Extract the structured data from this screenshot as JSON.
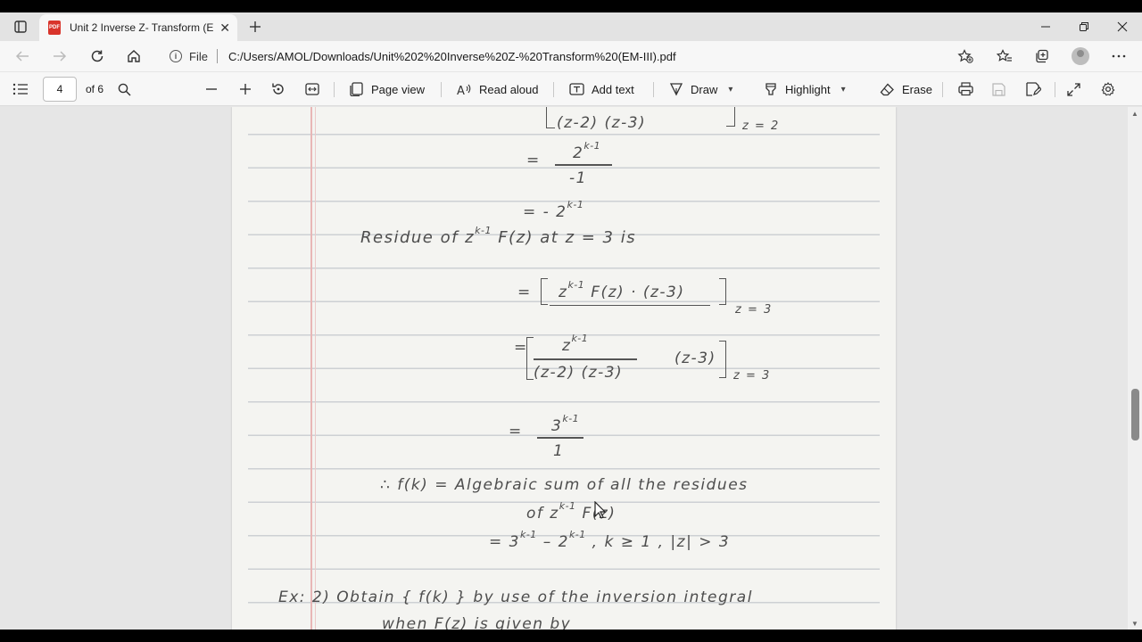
{
  "browser": {
    "tab_title": "Unit 2 Inverse Z- Transform (EM-III).pdf",
    "url_scheme_label": "File",
    "url": "C:/Users/AMOL/Downloads/Unit%202%20Inverse%20Z-%20Transform%20(EM-III).pdf",
    "pdf_badge": "PDF"
  },
  "pdf_toolbar": {
    "current_page": "4",
    "page_count_label": "of 6",
    "page_view_label": "Page view",
    "read_aloud_label": "Read aloud",
    "add_text_label": "Add text",
    "draw_label": "Draw",
    "highlight_label": "Highlight",
    "erase_label": "Erase"
  },
  "document": {
    "line1": "(z-2) (z-3)",
    "line1_sub": "z = 2",
    "line2_num": "2",
    "line2_num_sup": "k-1",
    "line2_den": "-1",
    "line3": "= - 2",
    "line3_sup": "k-1",
    "line4_a": "Residue  of  z",
    "line4_sup": "k-1",
    "line4_b": "F(z)  at  z = 3  is",
    "line5_a": "= ",
    "line5_z": "z",
    "line5_sup": "k-1",
    "line5_b": "F(z) · (z-3)",
    "line5_sub": "z = 3",
    "line6_eq": "=",
    "line6_num": "z",
    "line6_num_sup": "k-1",
    "line6_den": "(z-2) (z-3)",
    "line6_factor": "(z-3)",
    "line6_sub": "z = 3",
    "line7_eq": "=",
    "line7_num": "3",
    "line7_num_sup": "k-1",
    "line7_den": "1",
    "line8_a": "∴   f(k)   =  Algebraic  sum  of  all  the  residues",
    "line9_a": "of   z",
    "line9_sup": "k-1",
    "line9_b": " F(z)",
    "line10_a": "=  3",
    "line10_sup1": "k-1",
    "line10_b": " –  2",
    "line10_sup2": "k-1",
    "line10_c": "  ,  k ≥ 1 ,  |z| > 3",
    "line11": "Ex: 2)  Obtain  { f(k) }  by  use  of  the  inversion  integral",
    "line12": "when   F(z)   is   given  by"
  }
}
